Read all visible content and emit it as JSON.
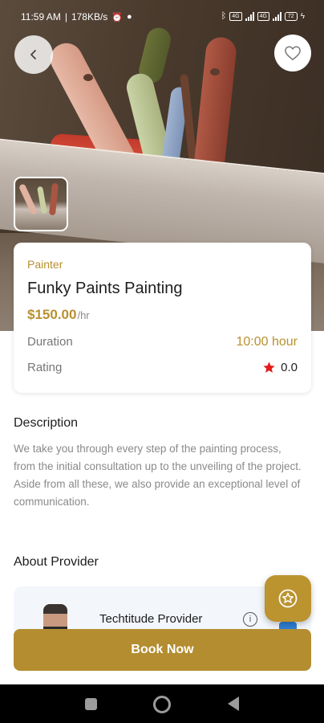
{
  "status_bar": {
    "time": "11:59 AM",
    "speed": "178KB/s",
    "battery": "72"
  },
  "service": {
    "category": "Painter",
    "title": "Funky Paints Painting",
    "price": "$150.00",
    "price_unit": "/hr",
    "duration_label": "Duration",
    "duration_value": "10:00 hour",
    "rating_label": "Rating",
    "rating_value": "0.0"
  },
  "description": {
    "heading": "Description",
    "text": "We take you through every step of the painting process, from the initial consultation up to the unveiling of the project. Aside from all these, we also provide an exceptional level of communication."
  },
  "provider": {
    "heading": "About Provider",
    "name": "Techtitude Provider"
  },
  "actions": {
    "book_now": "Book Now"
  },
  "icons": {
    "back": "chevron-left-icon",
    "favorite": "heart-icon",
    "rating": "star-icon",
    "fab": "star-badge-icon",
    "info": "info-icon"
  },
  "colors": {
    "accent": "#b38d30",
    "star": "#e31b1b",
    "verified": "#2f7fd6"
  }
}
